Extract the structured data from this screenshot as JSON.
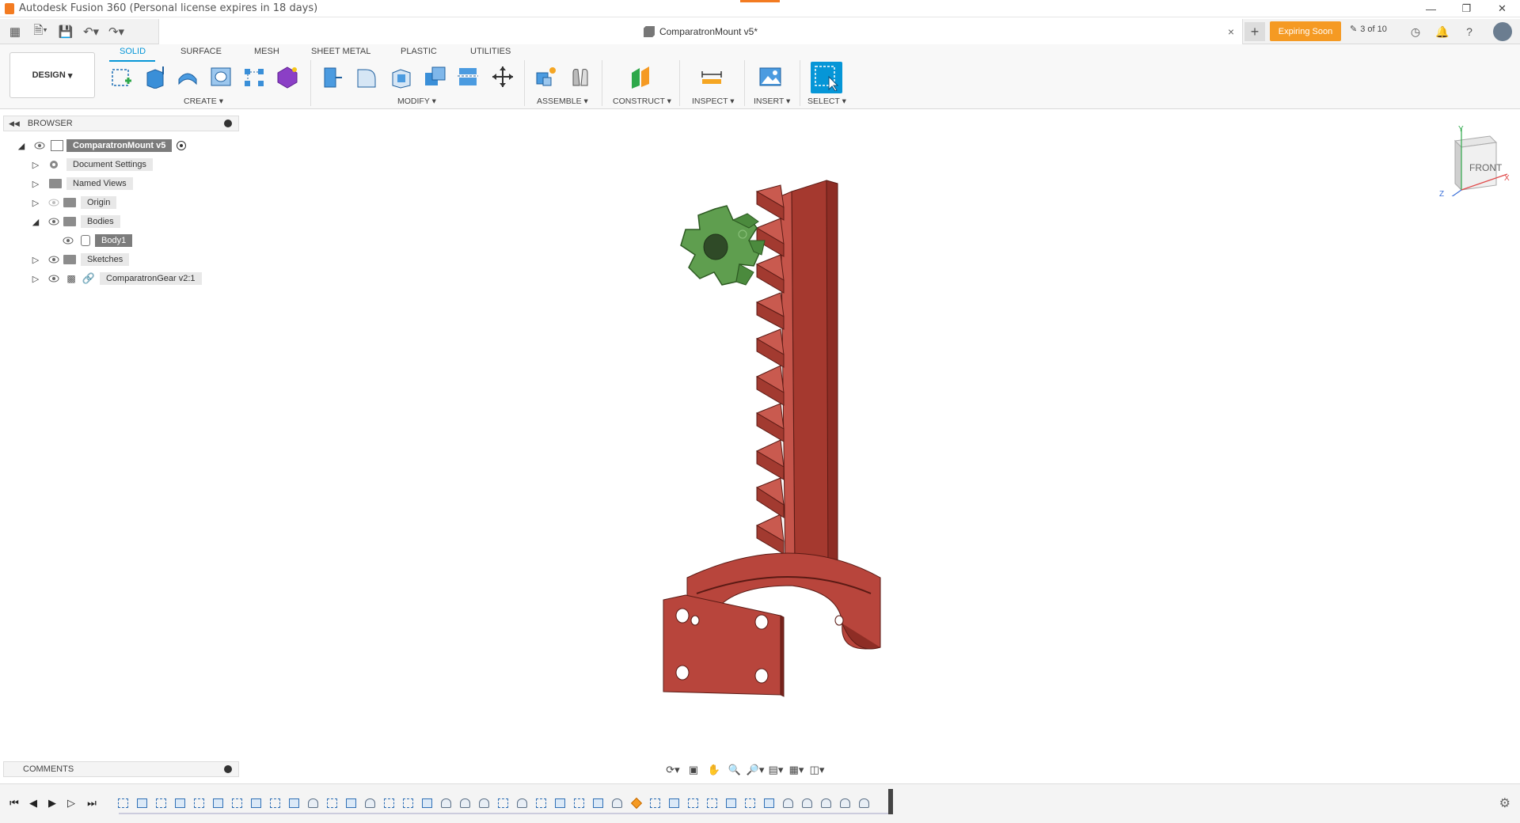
{
  "window": {
    "title": "Autodesk Fusion 360 (Personal license expires in 18 days)",
    "controls": [
      "minimize",
      "restore",
      "close"
    ]
  },
  "document_tab": {
    "title": "ComparatronMount v5*",
    "close": "×"
  },
  "header": {
    "expiring_label": "Expiring Soon",
    "job_status": "3 of 10"
  },
  "ribbon": {
    "workspace": "DESIGN",
    "tabs": [
      "SOLID",
      "SURFACE",
      "MESH",
      "SHEET METAL",
      "PLASTIC",
      "UTILITIES"
    ],
    "active_tab": "SOLID",
    "groups": [
      "CREATE",
      "MODIFY",
      "ASSEMBLE",
      "CONSTRUCT",
      "INSPECT",
      "INSERT",
      "SELECT"
    ]
  },
  "browser": {
    "title": "BROWSER",
    "root": "ComparatronMount v5",
    "items": [
      {
        "label": "Document Settings",
        "icon": "gear-icon"
      },
      {
        "label": "Named Views",
        "icon": "folder-icon"
      },
      {
        "label": "Origin",
        "icon": "folder-icon"
      },
      {
        "label": "Bodies",
        "icon": "folder-icon"
      },
      {
        "label": "Body1",
        "icon": "body-icon"
      },
      {
        "label": "Sketches",
        "icon": "folder-icon"
      },
      {
        "label": "ComparatronGear v2:1",
        "icon": "component-link-icon"
      }
    ]
  },
  "comments": {
    "title": "COMMENTS"
  },
  "viewcube": {
    "face": "FRONT",
    "axis_y": "Y",
    "axis_x": "X",
    "axis_z": "Z"
  },
  "colors": {
    "accent": "#0696d7",
    "expiring": "#f59a23",
    "mount_red": "#b8453c",
    "gear_green": "#5f9e4f"
  }
}
